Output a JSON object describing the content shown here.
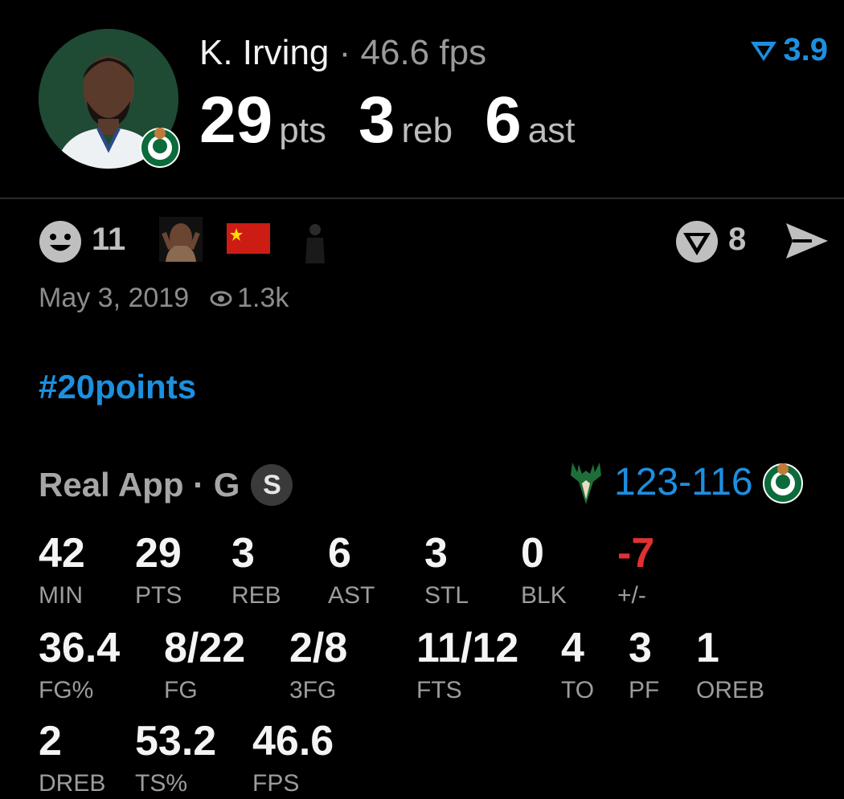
{
  "player": {
    "name": "K. Irving",
    "separator": "·",
    "fps": "46.6 fps"
  },
  "headline": [
    {
      "value": "29",
      "unit": "pts"
    },
    {
      "value": "3",
      "unit": "reb"
    },
    {
      "value": "6",
      "unit": "ast"
    }
  ],
  "rating": {
    "icon": "v-rating-icon",
    "value": "3.9"
  },
  "reactions": {
    "smiley_icon": "smiley-face-icon",
    "count": "11",
    "vote_icon": "vote-v-icon",
    "vote_count": "8",
    "share_icon": "share-arrow-icon"
  },
  "meta": {
    "date": "May 3, 2019",
    "views": "1.3k",
    "views_icon": "eye-icon"
  },
  "hashtag": "#20points",
  "game": {
    "source": "Real App · G",
    "badge": "S",
    "score_home": "123",
    "score_sep": "-",
    "score_away": "116"
  },
  "stats": [
    {
      "value": "42",
      "label": "MIN"
    },
    {
      "value": "29",
      "label": "PTS"
    },
    {
      "value": "3",
      "label": "REB"
    },
    {
      "value": "6",
      "label": "AST"
    },
    {
      "value": "3",
      "label": "STL"
    },
    {
      "value": "0",
      "label": "BLK"
    },
    {
      "value": "-7",
      "label": "+/-"
    },
    {
      "value": "36.4",
      "label": "FG%"
    },
    {
      "value": "8/22",
      "label": "FG"
    },
    {
      "value": "2/8",
      "label": "3FG"
    },
    {
      "value": "11/12",
      "label": "FTS"
    },
    {
      "value": "4",
      "label": "TO"
    },
    {
      "value": "3",
      "label": "PF"
    },
    {
      "value": "1",
      "label": "OREB"
    },
    {
      "value": "2",
      "label": "DREB"
    },
    {
      "value": "53.2",
      "label": "TS%"
    },
    {
      "value": "46.6",
      "label": "FPS"
    }
  ],
  "colors": {
    "accent": "#1d8fe0",
    "negative": "#e03131",
    "muted": "#9c9c9c",
    "background": "#000000"
  }
}
